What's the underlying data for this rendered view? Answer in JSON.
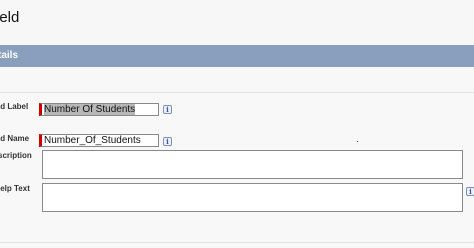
{
  "page": {
    "title": "ield"
  },
  "section": {
    "header": "tails"
  },
  "form": {
    "field_label": {
      "label": "ld Label",
      "value": "Number Of Students"
    },
    "field_name": {
      "label": "ld Name",
      "value": "Number_Of_Students"
    },
    "description": {
      "label": "scription",
      "value": ""
    },
    "help_text": {
      "label": "lelp Text",
      "value": ""
    },
    "info_glyph": "i"
  },
  "colors": {
    "header_bg": "#8a9ebe",
    "required_marker": "#cc0000"
  }
}
